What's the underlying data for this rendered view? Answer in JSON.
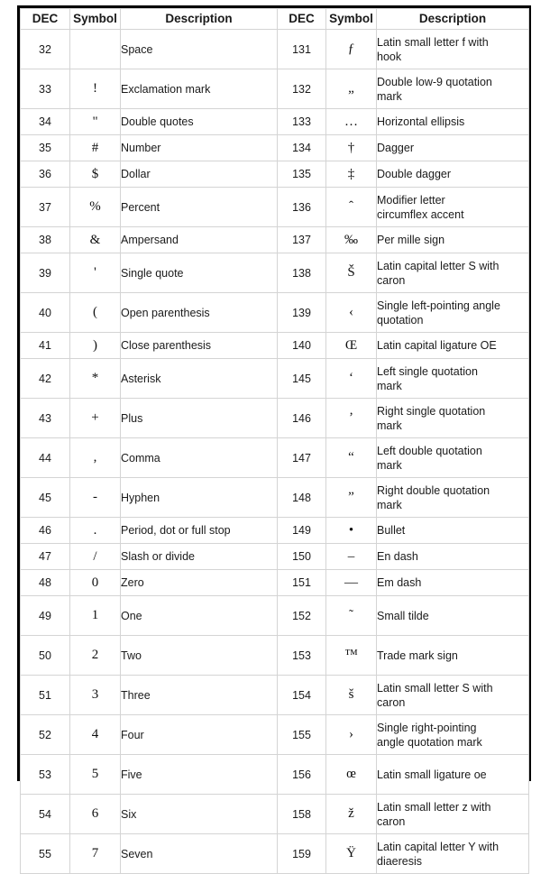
{
  "table": {
    "headers_left": {
      "dec": "DEC",
      "symbol": "Symbol",
      "description": "Description"
    },
    "headers_right": {
      "dec": "DEC",
      "symbol": "Symbol",
      "description": "Description"
    },
    "rows": [
      {
        "left": {
          "dec": "32",
          "symbol": "",
          "desc": [
            "Space"
          ]
        },
        "right": {
          "dec": "131",
          "symbol": "ƒ",
          "desc": [
            "Latin small letter f with",
            "hook"
          ]
        },
        "tall": true
      },
      {
        "left": {
          "dec": "33",
          "symbol": "!",
          "desc": [
            "Exclamation mark"
          ]
        },
        "right": {
          "dec": "132",
          "symbol": "„",
          "desc": [
            "Double low-9 quotation",
            "mark"
          ]
        },
        "tall": true
      },
      {
        "left": {
          "dec": "34",
          "symbol": "\"",
          "desc": [
            "Double quotes"
          ]
        },
        "right": {
          "dec": "133",
          "symbol": "…",
          "desc": [
            "Horizontal ellipsis"
          ]
        },
        "tall": false
      },
      {
        "left": {
          "dec": "35",
          "symbol": "#",
          "desc": [
            "Number"
          ]
        },
        "right": {
          "dec": "134",
          "symbol": "†",
          "desc": [
            "Dagger"
          ]
        },
        "tall": false
      },
      {
        "left": {
          "dec": "36",
          "symbol": "$",
          "desc": [
            "Dollar"
          ]
        },
        "right": {
          "dec": "135",
          "symbol": "‡",
          "desc": [
            "Double dagger"
          ]
        },
        "tall": false
      },
      {
        "left": {
          "dec": "37",
          "symbol": "%",
          "desc": [
            "Percent"
          ]
        },
        "right": {
          "dec": "136",
          "symbol": "ˆ",
          "desc": [
            "Modifier letter",
            "circumflex accent"
          ]
        },
        "tall": true
      },
      {
        "left": {
          "dec": "38",
          "symbol": "&",
          "desc": [
            "Ampersand"
          ]
        },
        "right": {
          "dec": "137",
          "symbol": "‰",
          "desc": [
            "Per mille sign"
          ]
        },
        "tall": false
      },
      {
        "left": {
          "dec": "39",
          "symbol": "'",
          "desc": [
            "Single quote"
          ]
        },
        "right": {
          "dec": "138",
          "symbol": "Š",
          "desc": [
            "Latin capital letter S with",
            "caron"
          ]
        },
        "tall": true
      },
      {
        "left": {
          "dec": "40",
          "symbol": "(",
          "desc": [
            "Open parenthesis"
          ]
        },
        "right": {
          "dec": "139",
          "symbol": "‹",
          "desc": [
            "Single left-pointing angle",
            "quotation"
          ]
        },
        "tall": true
      },
      {
        "left": {
          "dec": "41",
          "symbol": ")",
          "desc": [
            "Close parenthesis"
          ]
        },
        "right": {
          "dec": "140",
          "symbol": "Œ",
          "desc": [
            "Latin capital ligature OE"
          ]
        },
        "tall": false
      },
      {
        "left": {
          "dec": "42",
          "symbol": "*",
          "desc": [
            "Asterisk"
          ]
        },
        "right": {
          "dec": "145",
          "symbol": "‘",
          "desc": [
            "Left single quotation",
            "mark"
          ]
        },
        "tall": true
      },
      {
        "left": {
          "dec": "43",
          "symbol": "+",
          "desc": [
            "Plus"
          ]
        },
        "right": {
          "dec": "146",
          "symbol": "’",
          "desc": [
            "Right single quotation",
            "mark"
          ]
        },
        "tall": true
      },
      {
        "left": {
          "dec": "44",
          "symbol": ",",
          "desc": [
            "Comma"
          ]
        },
        "right": {
          "dec": "147",
          "symbol": "“",
          "desc": [
            "Left double quotation",
            "mark"
          ]
        },
        "tall": true
      },
      {
        "left": {
          "dec": "45",
          "symbol": "-",
          "desc": [
            "Hyphen"
          ]
        },
        "right": {
          "dec": "148",
          "symbol": "”",
          "desc": [
            "Right double quotation",
            "mark"
          ]
        },
        "tall": true
      },
      {
        "left": {
          "dec": "46",
          "symbol": ".",
          "desc": [
            "Period, dot or full stop"
          ]
        },
        "right": {
          "dec": "149",
          "symbol": "•",
          "desc": [
            "Bullet"
          ]
        },
        "tall": false
      },
      {
        "left": {
          "dec": "47",
          "symbol": "/",
          "desc": [
            "Slash or divide"
          ]
        },
        "right": {
          "dec": "150",
          "symbol": "–",
          "desc": [
            "En dash"
          ]
        },
        "tall": false
      },
      {
        "left": {
          "dec": "48",
          "symbol": "0",
          "desc": [
            "Zero"
          ]
        },
        "right": {
          "dec": "151",
          "symbol": "—",
          "desc": [
            "Em dash"
          ]
        },
        "tall": false
      },
      {
        "left": {
          "dec": "49",
          "symbol": "1",
          "desc": [
            "One"
          ]
        },
        "right": {
          "dec": "152",
          "symbol": "˜",
          "desc": [
            "Small tilde"
          ]
        },
        "tall": true
      },
      {
        "left": {
          "dec": "50",
          "symbol": "2",
          "desc": [
            "Two"
          ]
        },
        "right": {
          "dec": "153",
          "symbol": "™",
          "desc": [
            "Trade mark sign"
          ]
        },
        "tall": true
      },
      {
        "left": {
          "dec": "51",
          "symbol": "3",
          "desc": [
            "Three"
          ]
        },
        "right": {
          "dec": "154",
          "symbol": "š",
          "desc": [
            "Latin small letter S with",
            "caron"
          ]
        },
        "tall": true
      },
      {
        "left": {
          "dec": "52",
          "symbol": "4",
          "desc": [
            "Four"
          ]
        },
        "right": {
          "dec": "155",
          "symbol": "›",
          "desc": [
            "Single right-pointing",
            "angle quotation mark"
          ]
        },
        "tall": true
      },
      {
        "left": {
          "dec": "53",
          "symbol": "5",
          "desc": [
            "Five"
          ]
        },
        "right": {
          "dec": "156",
          "symbol": "œ",
          "desc": [
            "Latin small ligature oe"
          ]
        },
        "tall": true
      },
      {
        "left": {
          "dec": "54",
          "symbol": "6",
          "desc": [
            "Six"
          ]
        },
        "right": {
          "dec": "158",
          "symbol": "ž",
          "desc": [
            "Latin small letter z with",
            "caron"
          ]
        },
        "tall": true
      },
      {
        "left": {
          "dec": "55",
          "symbol": "7",
          "desc": [
            "Seven"
          ]
        },
        "right": {
          "dec": "159",
          "symbol": "Ÿ",
          "desc": [
            "Latin capital letter Y with",
            "diaeresis"
          ]
        },
        "tall": true
      }
    ]
  },
  "colors": {
    "frame": "#000000",
    "grid": "#d4d4d4",
    "header_rule": "#1a1a1a",
    "text": "#1a1a1a",
    "background": "#ffffff"
  }
}
